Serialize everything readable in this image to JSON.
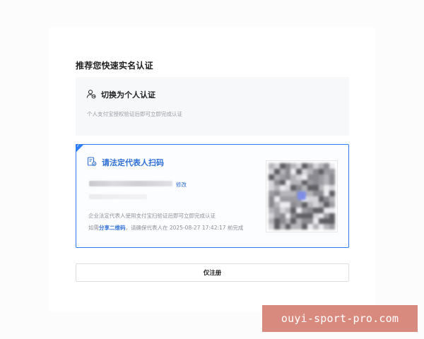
{
  "heading": "推荐您快速实名认证",
  "personal_option": {
    "title": "切换为个人认证",
    "description": "个人支付宝授权验证后即可立即完成认证",
    "icon": "person-switch-icon"
  },
  "legal_option": {
    "title": "请法定代表人扫码",
    "icon": "document-scan-icon",
    "edit_label": "修改",
    "description": "企业法定代表人使用支付宝扫验证后即可立即完成认证",
    "note_prefix": "如需",
    "share_label": "分享二维码",
    "note_suffix": "，请确保代表人在 2025-08-27 17:42:17 前完成",
    "accent_color": "#2f7df6"
  },
  "register_button": {
    "label": "仅注册"
  },
  "watermark": {
    "text": "ouyi-sport-pro.com"
  }
}
